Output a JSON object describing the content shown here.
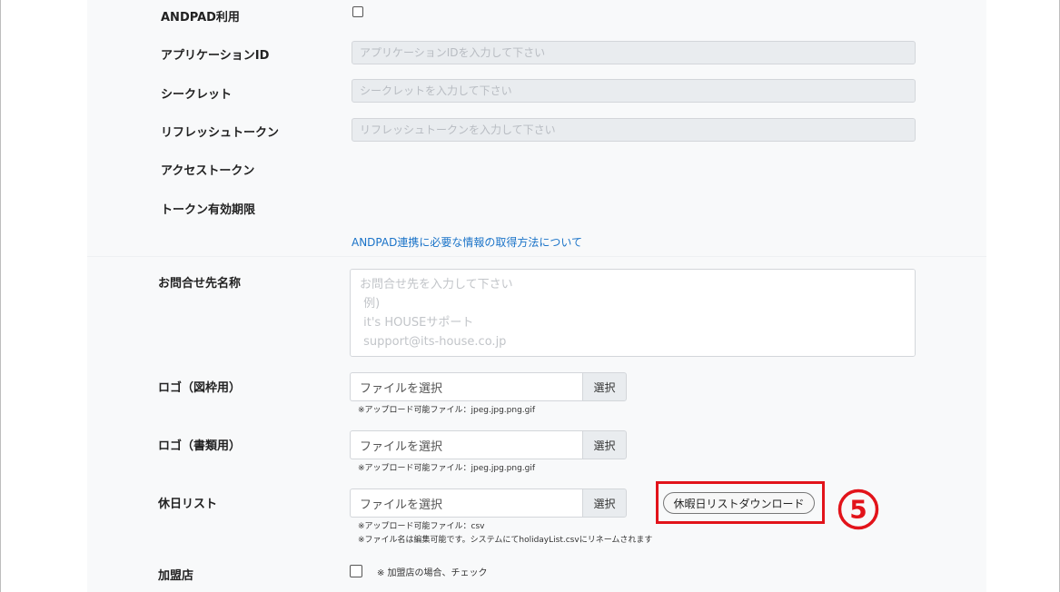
{
  "andpad_section": {
    "use_label": "ANDPAD利用",
    "application_id": {
      "label": "アプリケーションID",
      "placeholder": "アプリケーションIDを入力して下さい"
    },
    "secret": {
      "label": "シークレット",
      "placeholder": "シークレットを入力して下さい"
    },
    "refresh_token": {
      "label": "リフレッシュトークン",
      "placeholder": "リフレッシュトークンを入力して下さい"
    },
    "access_token_label": "アクセストークン",
    "token_expiry_label": "トークン有効期限",
    "info_link": "ANDPAD連携に必要な情報の取得方法について"
  },
  "contact": {
    "label": "お問合せ先名称",
    "placeholder": "お問合せ先を入力して下さい\n 例)\n it's HOUSEサポート\n support@its-house.co.jp"
  },
  "logo_frame": {
    "label": "ロゴ（図枠用）",
    "file_placeholder": "ファイルを選択",
    "select_button": "選択",
    "note": "※アップロード可能ファイル：jpeg.jpg.png.gif"
  },
  "logo_docs": {
    "label": "ロゴ（書類用）",
    "file_placeholder": "ファイルを選択",
    "select_button": "選択",
    "note": "※アップロード可能ファイル：jpeg.jpg.png.gif"
  },
  "holiday_list": {
    "label": "休日リスト",
    "file_placeholder": "ファイルを選択",
    "select_button": "選択",
    "note1": "※アップロード可能ファイル：csv",
    "note2": "※ファイル名は編集可能です。システムにてholidayList.csvにリネームされます",
    "download_button": "休暇日リストダウンロード"
  },
  "franchise": {
    "label": "加盟店",
    "note": "※ 加盟店の場合、チェック"
  },
  "annotation": {
    "step_number": "5",
    "highlight_color": "#e2131a"
  }
}
